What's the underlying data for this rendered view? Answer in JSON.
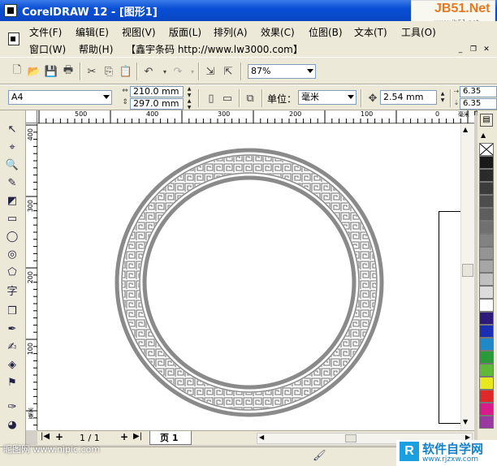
{
  "window": {
    "title": "CorelDRAW 12 - [图形1]"
  },
  "watermark_top": {
    "line1": "JB51.Net",
    "line2": "www.jb51.net"
  },
  "menu": {
    "row1": [
      "文件(F)",
      "编辑(E)",
      "视图(V)",
      "版面(L)",
      "排列(A)",
      "效果(C)",
      "位图(B)",
      "文本(T)",
      "工具(O)"
    ],
    "row2": [
      "窗口(W)",
      "帮助(H)",
      "【鑫宇条码 http://www.lw3000.com】"
    ]
  },
  "toolbar": {
    "zoom": "87%"
  },
  "property_bar": {
    "paper": "A4",
    "width": "210.0 mm",
    "height": "297.0 mm",
    "unit_label": "单位：",
    "unit_value": "毫米",
    "nudge": "2.54 mm",
    "dup_x": "6.35 mm",
    "dup_y": "6.35 mm"
  },
  "ruler": {
    "h_labels": [
      "500",
      "400",
      "300",
      "200",
      "100",
      "0"
    ],
    "h_unit": "毫米",
    "v_labels": [
      "400",
      "300",
      "200",
      "100"
    ],
    "v_unit": "毫米"
  },
  "page_nav": {
    "counter": "1 / 1",
    "tab": "页 1"
  },
  "palette": {
    "colors": [
      "#ffffff",
      "#1a1a1a",
      "#2b2b2b",
      "#3c3c3c",
      "#4d4d4d",
      "#5e5e5e",
      "#707070",
      "#828282",
      "#949494",
      "#a6a6a6",
      "#c0c0c0",
      "#dcdcdc",
      "#ffffff",
      "#2e1a7a",
      "#1a2fb4",
      "#1e88c8",
      "#2a9a3a",
      "#60b83a",
      "#e8e820",
      "#e02828",
      "#d81a8a",
      "#9a3aa0"
    ]
  },
  "watermark_bottom": {
    "left": "昵图网 www.nipic.com",
    "right_title": "软件自学网",
    "right_url": "www.rjzxw.com"
  },
  "accent": {
    "title_bar": "#0a4fd6",
    "ring": "#8a8a8a"
  }
}
